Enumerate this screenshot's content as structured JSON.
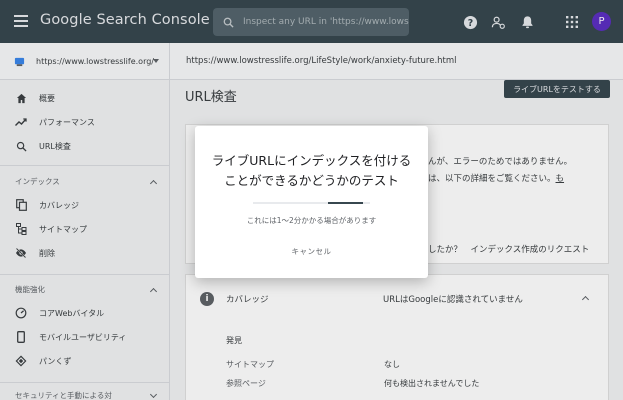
{
  "app": {
    "title": "Google Search Console",
    "search_placeholder": "Inspect any URL in 'https://www.lowstr",
    "avatar_letter": "P"
  },
  "property": {
    "selected": "https://www.lowstresslife.org/",
    "inspected_url": "https://www.lowstresslife.org/LifeStyle/work/anxiety-future.html"
  },
  "sidebar": {
    "top_items": [
      {
        "label": "概要",
        "icon": "home-icon"
      },
      {
        "label": "パフォーマンス",
        "icon": "trending-icon"
      },
      {
        "label": "URL検査",
        "icon": "search-icon"
      }
    ],
    "sections": [
      {
        "title": "インデックス",
        "items": [
          {
            "label": "カバレッジ",
            "icon": "copy-icon"
          },
          {
            "label": "サイトマップ",
            "icon": "sitemap-icon"
          },
          {
            "label": "削除",
            "icon": "eye-off-icon"
          }
        ]
      },
      {
        "title": "機能強化",
        "items": [
          {
            "label": "コアWebバイタル",
            "icon": "speed-icon"
          },
          {
            "label": "モバイルユーザビリティ",
            "icon": "phone-icon"
          },
          {
            "label": "パンくず",
            "icon": "layers-icon"
          }
        ]
      },
      {
        "title": "セキュリティと手動による対"
      }
    ]
  },
  "main": {
    "page_title": "URL検査",
    "live_test_button": "ライブURLをテストする",
    "status_line1": "んが、エラーのためではありません。",
    "status_line2": "は、以下の詳細をご覧ください。",
    "status_link": "も",
    "request_line": "したか？　インデックス作成のリクエスト",
    "coverage": {
      "label": "カバレッジ",
      "status": "URLはGoogleに認識されていません",
      "discovery_heading": "発見",
      "rows": [
        {
          "label": "サイトマップ",
          "value": "なし"
        },
        {
          "label": "参照ページ",
          "value": "何も検出されませんでした"
        }
      ]
    }
  },
  "dialog": {
    "title": "ライブURLにインデックスを付けることができるかどうかのテスト",
    "note": "これには1〜2分かかる場合があります",
    "cancel_label": "キャンセル",
    "progress": 0.3
  }
}
